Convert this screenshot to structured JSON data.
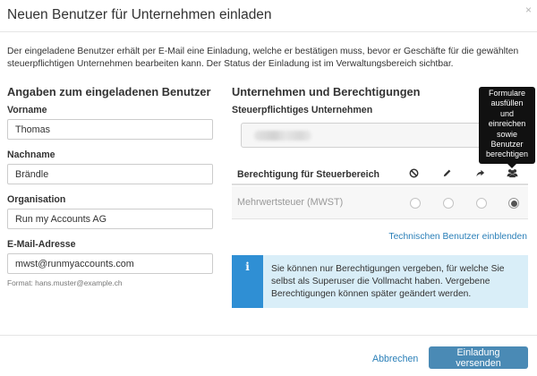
{
  "modal": {
    "title": "Neuen Benutzer für Unternehmen einladen",
    "close_icon": "×",
    "intro": "Der eingeladene Benutzer erhält per E-Mail eine Einladung, welche er bestätigen muss, bevor er Geschäfte für die gewählten steuerpflichtigen Unternehmen bearbeiten kann. Der Status der Einladung ist im Verwaltungsbereich sichtbar."
  },
  "left": {
    "section_title": "Angaben zum eingeladenen Benutzer",
    "firstname": {
      "label": "Vorname",
      "value": "Thomas"
    },
    "lastname": {
      "label": "Nachname",
      "value": "Brändle"
    },
    "organisation": {
      "label": "Organisation",
      "value": "Run my Accounts AG"
    },
    "email": {
      "label": "E-Mail-Adresse",
      "value": "mwst@runmyaccounts.com",
      "hint": "Format: hans.muster@example.ch"
    }
  },
  "right": {
    "section_title": "Unternehmen und Berechtigungen",
    "company_label": "Steuerpflichtiges Unternehmen",
    "tooltip": [
      "Formulare",
      "ausfüllen",
      "und",
      "einreichen",
      "sowie",
      "Benutzer",
      "berechtigen"
    ],
    "permissions": {
      "header_label": "Berechtigung für Steuerbereich",
      "icons": [
        "ban-icon",
        "pencil-icon",
        "share-icon",
        "users-icon"
      ],
      "rows": [
        {
          "label": "Mehrwertsteuer (MWST)",
          "selected": 3
        }
      ]
    },
    "technical_users_link": "Technischen Benutzer einblenden",
    "info_icon": "i",
    "info_text": "Sie können nur Berechtigungen vergeben, für welche Sie selbst als Superuser die Vollmacht haben. Vergebene Berechtigungen können später geändert werden."
  },
  "footer": {
    "cancel_label": "Abbrechen",
    "submit_label": "Einladung versenden"
  },
  "colors": {
    "primary_button": "#4a8ab5",
    "link": "#2a7fb8",
    "info_bg": "#d9eef8",
    "info_accent": "#2f8fd4",
    "tooltip_bg": "#111111"
  }
}
